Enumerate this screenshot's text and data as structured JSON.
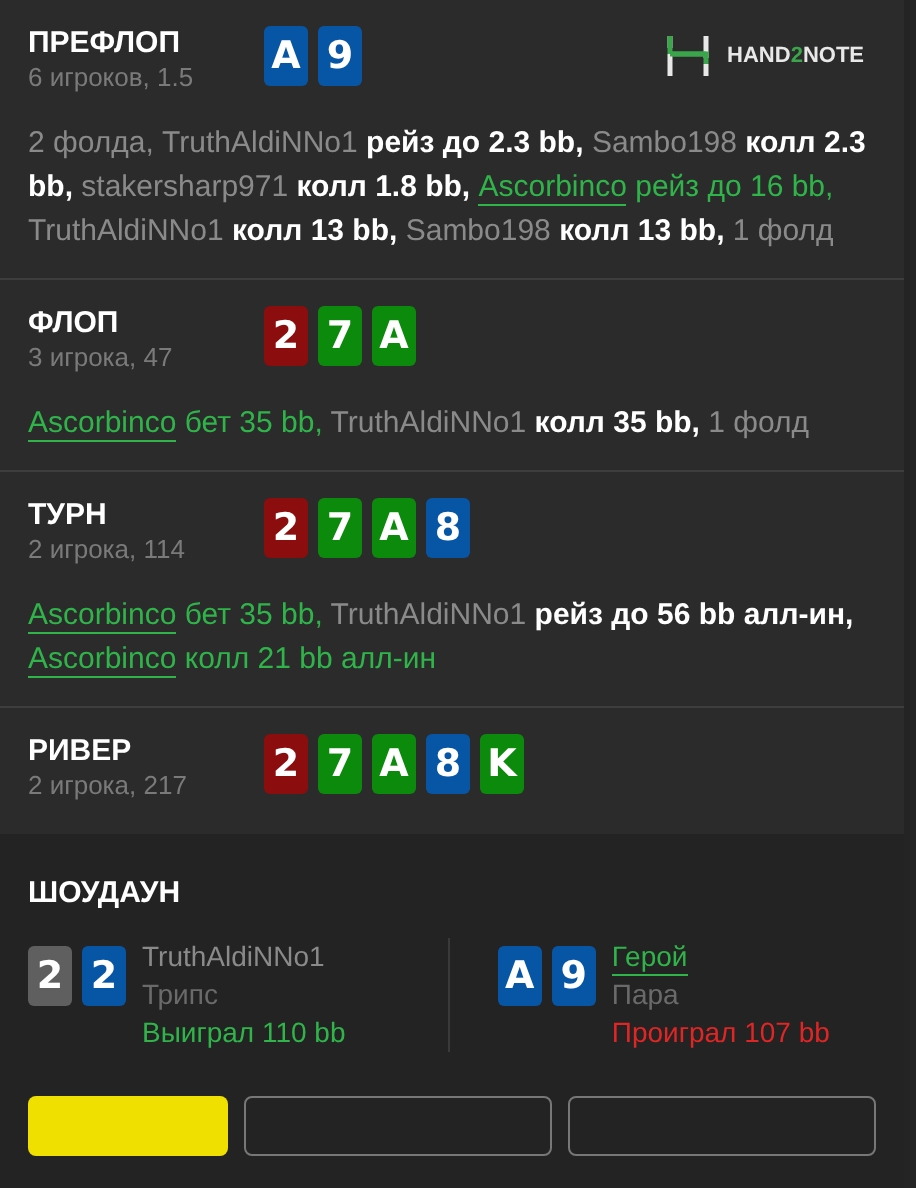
{
  "logo": {
    "text_a": "HAND",
    "text_b": "2",
    "text_c": "NOTE"
  },
  "streets": [
    {
      "title": "ПРЕФЛОП",
      "info": "6 игроков, 1.5",
      "cards": [
        {
          "rank": "A",
          "color": "#0756a6"
        },
        {
          "rank": "9",
          "color": "#0756a6"
        }
      ],
      "actions": [
        {
          "text": "2 фолда, ",
          "kind": "muted"
        },
        {
          "text": "TruthAldiNNo1",
          "kind": "player"
        },
        {
          "text": " рейз до 2.3 bb, ",
          "kind": "action"
        },
        {
          "text": "Sambo198",
          "kind": "player"
        },
        {
          "text": " колл 2.3 bb, ",
          "kind": "action"
        },
        {
          "text": "stakersharp971",
          "kind": "player"
        },
        {
          "text": " колл 1.8 bb, ",
          "kind": "action"
        },
        {
          "text": "Ascorbinco",
          "kind": "hero"
        },
        {
          "text": " рейз до 16 bb, ",
          "kind": "hero-action"
        },
        {
          "text": "TruthAldiNNo1",
          "kind": "player"
        },
        {
          "text": " колл 13 bb, ",
          "kind": "action"
        },
        {
          "text": "Sambo198",
          "kind": "player"
        },
        {
          "text": " колл 13 bb, ",
          "kind": "action"
        },
        {
          "text": "1 фолд",
          "kind": "muted"
        }
      ]
    },
    {
      "title": "ФЛОП",
      "info": "3 игрока, 47",
      "cards": [
        {
          "rank": "2",
          "color": "#8c0d0d"
        },
        {
          "rank": "7",
          "color": "#0b8a0b"
        },
        {
          "rank": "A",
          "color": "#0b8a0b"
        }
      ],
      "actions": [
        {
          "text": "Ascorbinco",
          "kind": "hero"
        },
        {
          "text": " бет 35 bb, ",
          "kind": "hero-action"
        },
        {
          "text": "TruthAldiNNo1",
          "kind": "player"
        },
        {
          "text": " колл 35 bb, ",
          "kind": "action"
        },
        {
          "text": "1 фолд",
          "kind": "muted"
        }
      ]
    },
    {
      "title": "ТУРН",
      "info": "2 игрока, 114",
      "cards": [
        {
          "rank": "2",
          "color": "#8c0d0d"
        },
        {
          "rank": "7",
          "color": "#0b8a0b"
        },
        {
          "rank": "A",
          "color": "#0b8a0b"
        },
        {
          "rank": "8",
          "color": "#0756a6"
        }
      ],
      "actions": [
        {
          "text": "Ascorbinco",
          "kind": "hero"
        },
        {
          "text": " бет 35 bb, ",
          "kind": "hero-action"
        },
        {
          "text": "TruthAldiNNo1",
          "kind": "player"
        },
        {
          "text": " рейз до 56 bb алл-ин, ",
          "kind": "action"
        },
        {
          "text": "Ascorbinco",
          "kind": "hero"
        },
        {
          "text": " колл 21 bb алл-ин",
          "kind": "hero-action"
        }
      ]
    },
    {
      "title": "РИВЕР",
      "info": "2 игрока, 217",
      "cards": [
        {
          "rank": "2",
          "color": "#8c0d0d"
        },
        {
          "rank": "7",
          "color": "#0b8a0b"
        },
        {
          "rank": "A",
          "color": "#0b8a0b"
        },
        {
          "rank": "8",
          "color": "#0756a6"
        },
        {
          "rank": "K",
          "color": "#0b8a0b"
        }
      ]
    }
  ],
  "showdown": {
    "title": "ШОУДАУН",
    "players": [
      {
        "name": "TruthAldiNNo1",
        "hero": false,
        "hand": "Трипс",
        "result": "Выиграл 110 bb",
        "won": true,
        "cards": [
          {
            "rank": "2",
            "color": "#5f5f5f"
          },
          {
            "rank": "2",
            "color": "#0756a6"
          }
        ]
      },
      {
        "name": "Герой",
        "hero": true,
        "hand": "Пара",
        "result": "Проиграл 107 bb",
        "won": false,
        "cards": [
          {
            "rank": "A",
            "color": "#0756a6"
          },
          {
            "rank": "9",
            "color": "#0756a6"
          }
        ]
      }
    ]
  },
  "buttons": [
    {
      "kind": "primary"
    },
    {
      "kind": "outline"
    },
    {
      "kind": "outline"
    }
  ]
}
